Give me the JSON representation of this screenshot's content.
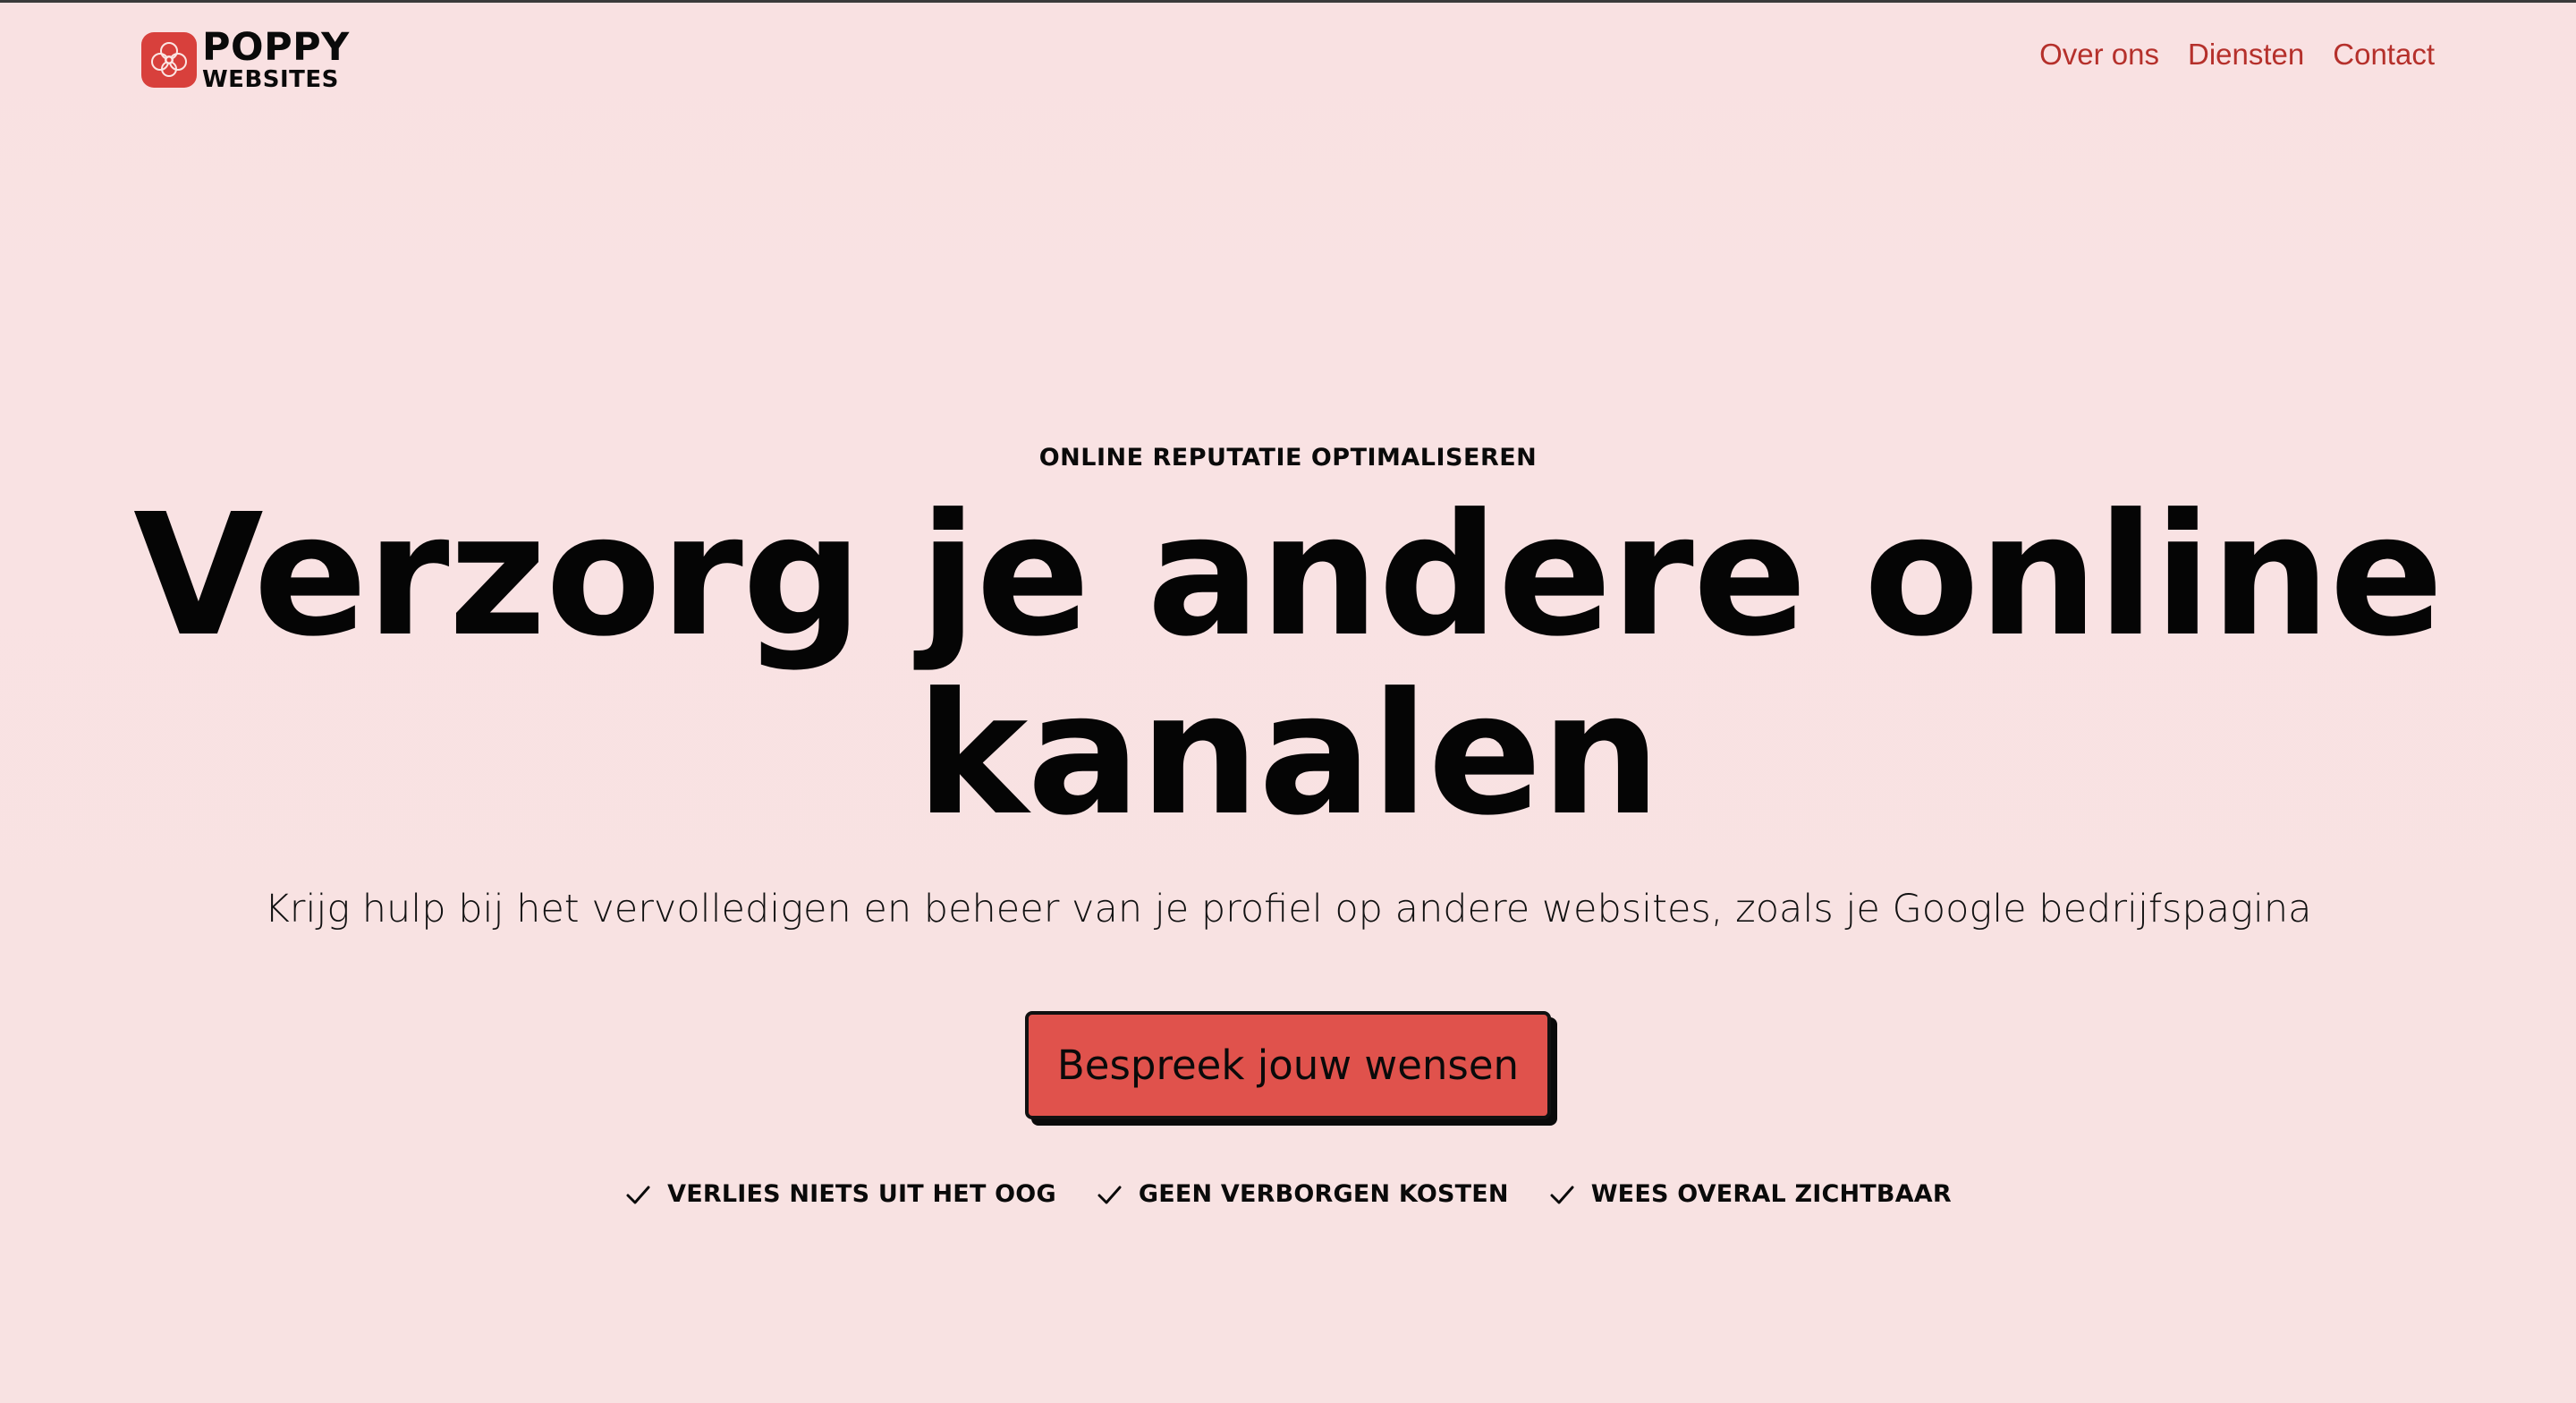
{
  "brand": {
    "name_line1": "POPPY",
    "name_line2": "WEBSITES",
    "badge_color": "#d8403c",
    "logo_icon": "poppy-flower-icon"
  },
  "nav": {
    "items": [
      {
        "label": "Over ons"
      },
      {
        "label": "Diensten"
      },
      {
        "label": "Contact"
      }
    ],
    "link_color": "#b5302b"
  },
  "hero": {
    "eyebrow": "ONLINE REPUTATIE OPTIMALISEREN",
    "headline_line1": "Verzorg je andere online",
    "headline_line2": "kanalen",
    "subline": "Krijg hulp bij het vervolledigen en beheer van je profiel op andere websites, zoals je Google bedrijfspagina",
    "cta_label": "Bespreek jouw wensen",
    "cta_color": "#e0524c",
    "features": [
      {
        "icon": "check-icon",
        "label": "VERLIES NIETS UIT HET OOG"
      },
      {
        "icon": "check-icon",
        "label": "GEEN VERBORGEN KOSTEN"
      },
      {
        "icon": "check-icon",
        "label": "WEES OVERAL ZICHTBAAR"
      }
    ]
  },
  "colors": {
    "background": "#f9e1e2",
    "text": "#0a0a0a"
  }
}
